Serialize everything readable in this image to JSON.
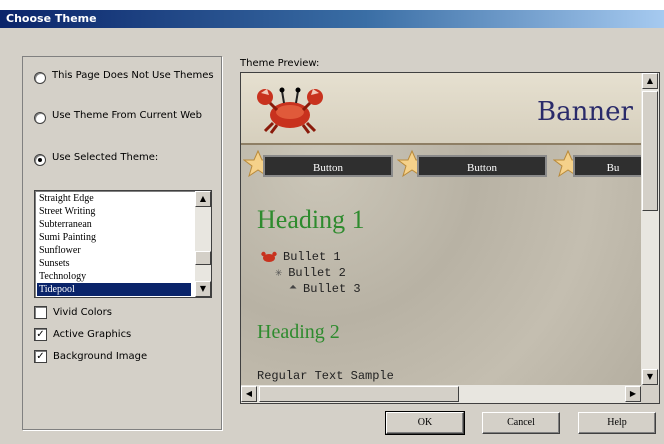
{
  "window": {
    "title": "Choose Theme"
  },
  "options": {
    "radio_no_themes": "This Page Does Not Use Themes",
    "radio_current_web": "Use Theme From Current Web",
    "radio_selected": "Use Selected Theme:",
    "selected_radio": "radio_selected"
  },
  "theme_list": {
    "items": [
      "Straight Edge",
      "Street Writing",
      "Subterranean",
      "Sumi Painting",
      "Sunflower",
      "Sunsets",
      "Technology",
      "Tidepool"
    ],
    "selected": "Tidepool"
  },
  "checkboxes": {
    "vivid_colors": {
      "label": "Vivid Colors",
      "checked": false
    },
    "active_graphics": {
      "label": "Active Graphics",
      "checked": true
    },
    "background_image": {
      "label": "Background Image",
      "checked": true
    }
  },
  "preview": {
    "label": "Theme Preview:",
    "banner": "Banner",
    "nav_buttons": [
      "Button",
      "Button",
      "Bu"
    ],
    "heading1": "Heading 1",
    "bullets": [
      "Bullet 1",
      "Bullet 2",
      "Bullet 3"
    ],
    "heading2": "Heading 2",
    "regular_text": "Regular Text Sample"
  },
  "buttons": {
    "ok": "OK",
    "cancel": "Cancel",
    "help": "Help"
  },
  "icons": {
    "crab": "crab-icon",
    "star": "star-icon",
    "bullet1": "crab-bullet-icon",
    "bullet2": "sea-star-bullet-icon",
    "bullet3": "shell-bullet-icon",
    "scroll_up": "arrow-up-icon",
    "scroll_down": "arrow-down-icon",
    "scroll_left": "arrow-left-icon",
    "scroll_right": "arrow-right-icon"
  },
  "colors": {
    "titlebar": "#0a246a",
    "heading": "#2e8b2e",
    "banner_text": "#2a2a6a",
    "selection": "#0a246a"
  }
}
